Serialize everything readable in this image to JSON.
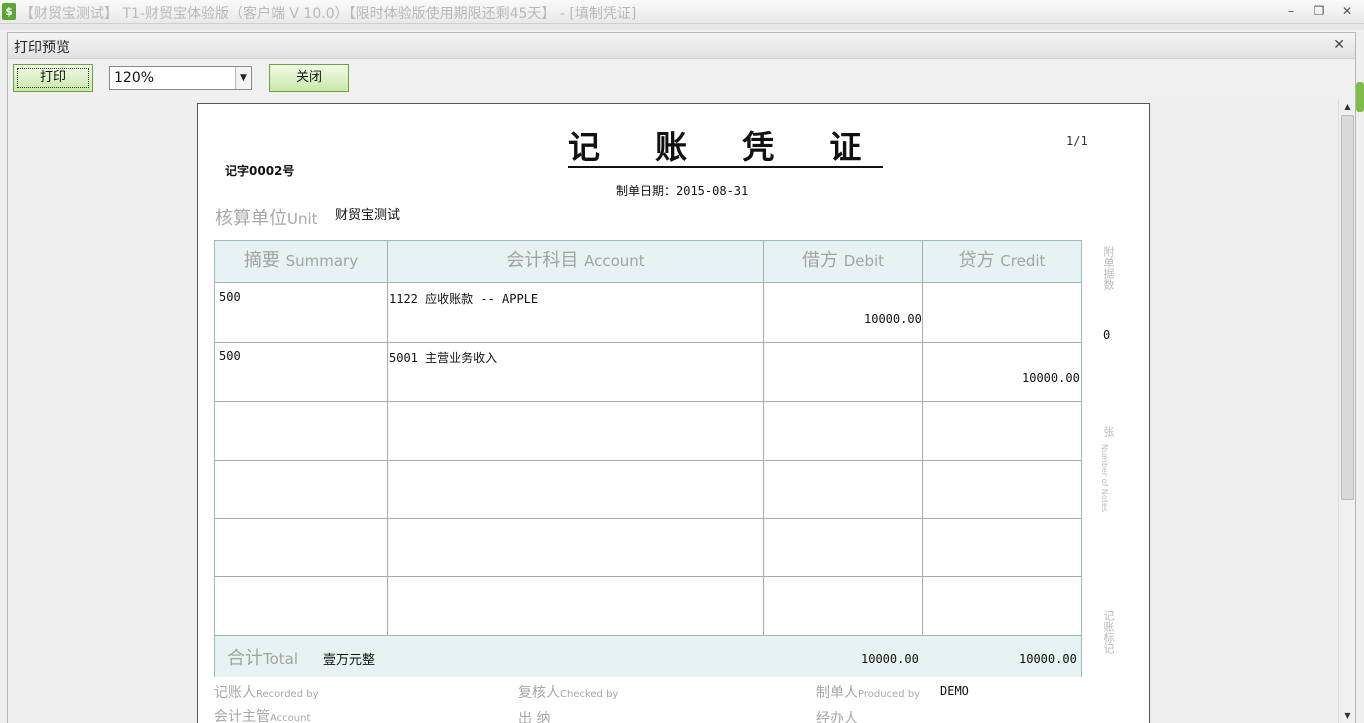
{
  "app": {
    "title": "【财贸宝测试】 T1-财贸宝体验版（客户端 V 10.0）【限时体验版使用期限还剩45天】 - [填制凭证]",
    "minimize_glyph": "–",
    "restore_glyph": "❐",
    "close_glyph": "✕",
    "icon_glyph": "$"
  },
  "dialog": {
    "title": "打印预览",
    "close_glyph": "✕",
    "print_label": "打印",
    "zoom_value": "120%",
    "close_label": "关闭"
  },
  "voucher": {
    "title": "记 账 凭 证",
    "page": "1/1",
    "number": "记字0002号",
    "date": "制单日期：2015-08-31",
    "unit_label": "核算单位",
    "unit_label_en": "Unit",
    "unit_value": "财贸宝测试",
    "headers": {
      "summary": "摘要",
      "summary_en": "Summary",
      "account": "会计科目",
      "account_en": "Account",
      "debit": "借方",
      "debit_en": "Debit",
      "credit": "贷方",
      "credit_en": "Credit"
    },
    "rows": [
      {
        "summary": "500",
        "account": "1122  应收账款 -- APPLE",
        "debit": "10000.00",
        "credit": ""
      },
      {
        "summary": "500",
        "account": "5001  主营业务收入",
        "debit": "",
        "credit": "10000.00"
      }
    ],
    "total_label": "合计",
    "total_label_en": "Total",
    "total_words": "壹万元整",
    "total_debit": "10000.00",
    "total_credit": "10000.00",
    "side": {
      "attachments_label": "附单据数",
      "attachments_value": "0",
      "sheets_label": "张",
      "sheets_label_en": "Number of Notes",
      "remark_label": "记账标记"
    },
    "signatures": {
      "recorded_by": "记账人",
      "recorded_by_en": "Recorded by",
      "checked_by": "复核人",
      "checked_by_en": "Checked by",
      "produced_by": "制单人",
      "produced_by_en": "Produced by",
      "produced_by_value": "DEMO",
      "account_manager": "会计主管",
      "account_manager_en": "Account",
      "cashier": "出 纳",
      "handler": "经办人"
    }
  }
}
